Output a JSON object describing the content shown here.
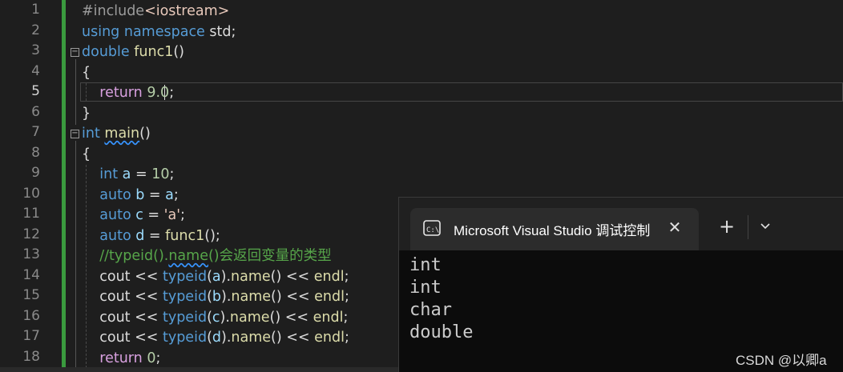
{
  "editor": {
    "line_numbers": [
      "1",
      "2",
      "3",
      "4",
      "5",
      "6",
      "7",
      "8",
      "9",
      "10",
      "11",
      "12",
      "13",
      "14",
      "15",
      "16",
      "17",
      "18"
    ],
    "active_line": "5",
    "lines": [
      [
        {
          "t": "#include",
          "c": "pp"
        },
        {
          "t": "<iostream>",
          "c": "inc"
        }
      ],
      [
        {
          "t": "using",
          "c": "kw"
        },
        {
          "t": " ",
          "c": "plain"
        },
        {
          "t": "namespace",
          "c": "kw"
        },
        {
          "t": " std;",
          "c": "plain"
        }
      ],
      [
        {
          "t": "double",
          "c": "kw"
        },
        {
          "t": " ",
          "c": "plain"
        },
        {
          "t": "func1",
          "c": "fn"
        },
        {
          "t": "()",
          "c": "plain"
        }
      ],
      [
        {
          "t": "{",
          "c": "plain"
        }
      ],
      [
        {
          "t": "    ",
          "c": "plain"
        },
        {
          "t": "return",
          "c": "ctl"
        },
        {
          "t": " ",
          "c": "plain"
        },
        {
          "t": "9.0",
          "c": "num"
        },
        {
          "t": ";",
          "c": "plain"
        }
      ],
      [
        {
          "t": "}",
          "c": "plain"
        }
      ],
      [
        {
          "t": "int",
          "c": "kw"
        },
        {
          "t": " ",
          "c": "plain"
        },
        {
          "t": "main",
          "c": "fn squig"
        },
        {
          "t": "()",
          "c": "plain"
        }
      ],
      [
        {
          "t": "{",
          "c": "plain"
        }
      ],
      [
        {
          "t": "    ",
          "c": "plain"
        },
        {
          "t": "int",
          "c": "kw"
        },
        {
          "t": " ",
          "c": "plain"
        },
        {
          "t": "a",
          "c": "var"
        },
        {
          "t": " = ",
          "c": "plain"
        },
        {
          "t": "10",
          "c": "num"
        },
        {
          "t": ";",
          "c": "plain"
        }
      ],
      [
        {
          "t": "    ",
          "c": "plain"
        },
        {
          "t": "auto",
          "c": "kw"
        },
        {
          "t": " ",
          "c": "plain"
        },
        {
          "t": "b",
          "c": "var"
        },
        {
          "t": " = ",
          "c": "plain"
        },
        {
          "t": "a",
          "c": "var"
        },
        {
          "t": ";",
          "c": "plain"
        }
      ],
      [
        {
          "t": "    ",
          "c": "plain"
        },
        {
          "t": "auto",
          "c": "kw"
        },
        {
          "t": " ",
          "c": "plain"
        },
        {
          "t": "c",
          "c": "var"
        },
        {
          "t": " = ",
          "c": "plain"
        },
        {
          "t": "'a'",
          "c": "str"
        },
        {
          "t": ";",
          "c": "plain"
        }
      ],
      [
        {
          "t": "    ",
          "c": "plain"
        },
        {
          "t": "auto",
          "c": "kw"
        },
        {
          "t": " ",
          "c": "plain"
        },
        {
          "t": "d",
          "c": "var"
        },
        {
          "t": " = ",
          "c": "plain"
        },
        {
          "t": "func1",
          "c": "fn"
        },
        {
          "t": "();",
          "c": "plain"
        }
      ],
      [
        {
          "t": "    ",
          "c": "plain"
        },
        {
          "t": "//typeid().",
          "c": "cm"
        },
        {
          "t": "name",
          "c": "cm squig"
        },
        {
          "t": "()会返回变量的类型",
          "c": "cm"
        }
      ],
      [
        {
          "t": "    cout << ",
          "c": "plain"
        },
        {
          "t": "typeid",
          "c": "kw"
        },
        {
          "t": "(",
          "c": "plain"
        },
        {
          "t": "a",
          "c": "var"
        },
        {
          "t": ").",
          "c": "plain"
        },
        {
          "t": "name",
          "c": "fn"
        },
        {
          "t": "() << ",
          "c": "plain"
        },
        {
          "t": "endl",
          "c": "fn"
        },
        {
          "t": ";",
          "c": "plain"
        }
      ],
      [
        {
          "t": "    cout << ",
          "c": "plain"
        },
        {
          "t": "typeid",
          "c": "kw"
        },
        {
          "t": "(",
          "c": "plain"
        },
        {
          "t": "b",
          "c": "var"
        },
        {
          "t": ").",
          "c": "plain"
        },
        {
          "t": "name",
          "c": "fn"
        },
        {
          "t": "() << ",
          "c": "plain"
        },
        {
          "t": "endl",
          "c": "fn"
        },
        {
          "t": ";",
          "c": "plain"
        }
      ],
      [
        {
          "t": "    cout << ",
          "c": "plain"
        },
        {
          "t": "typeid",
          "c": "kw"
        },
        {
          "t": "(",
          "c": "plain"
        },
        {
          "t": "c",
          "c": "var"
        },
        {
          "t": ").",
          "c": "plain"
        },
        {
          "t": "name",
          "c": "fn"
        },
        {
          "t": "() << ",
          "c": "plain"
        },
        {
          "t": "endl",
          "c": "fn"
        },
        {
          "t": ";",
          "c": "plain"
        }
      ],
      [
        {
          "t": "    cout << ",
          "c": "plain"
        },
        {
          "t": "typeid",
          "c": "kw"
        },
        {
          "t": "(",
          "c": "plain"
        },
        {
          "t": "d",
          "c": "var"
        },
        {
          "t": ").",
          "c": "plain"
        },
        {
          "t": "name",
          "c": "fn"
        },
        {
          "t": "() << ",
          "c": "plain"
        },
        {
          "t": "endl",
          "c": "fn"
        },
        {
          "t": ";",
          "c": "plain"
        }
      ],
      [
        {
          "t": "    ",
          "c": "plain"
        },
        {
          "t": "return",
          "c": "ctl"
        },
        {
          "t": " ",
          "c": "plain"
        },
        {
          "t": "0",
          "c": "num"
        },
        {
          "t": ";",
          "c": "plain"
        }
      ]
    ]
  },
  "console": {
    "tab_title": "Microsoft Visual Studio 调试控制台",
    "tab_icon": "console-icon",
    "close_icon": "close-icon",
    "new_tab_label": "+",
    "dropdown_icon": "chevron-down-icon",
    "output": [
      "int",
      "int",
      "char",
      "double"
    ]
  },
  "watermark": "CSDN @以卿a",
  "colors": {
    "background": "#1e1e1e",
    "change_bar": "#3a9a3e",
    "console_bg": "#0c0c0c",
    "tab_bg": "#2c2c2c"
  }
}
